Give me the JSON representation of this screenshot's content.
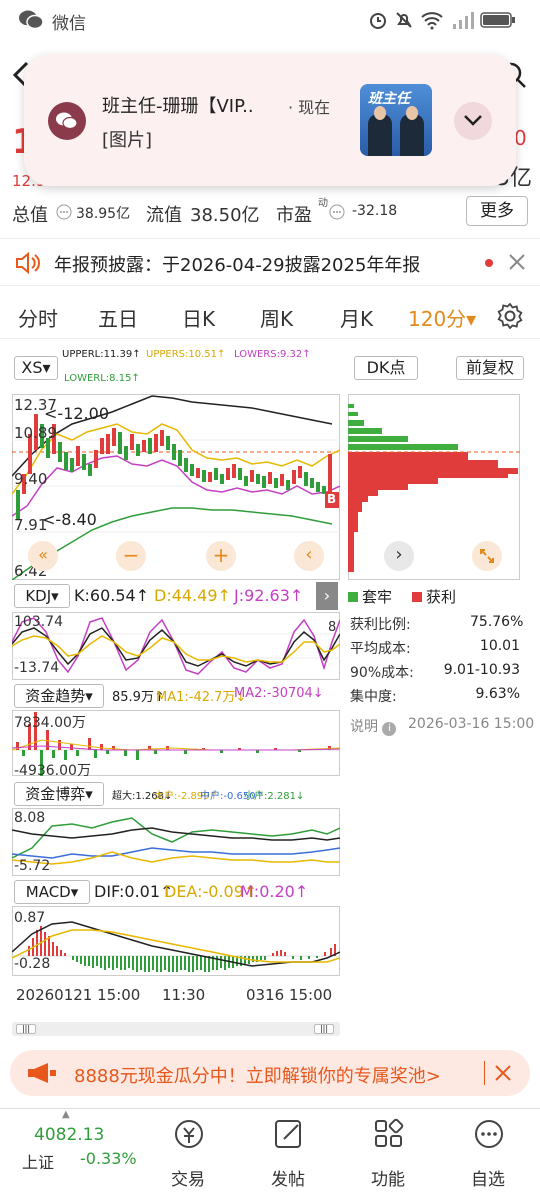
{
  "status": {
    "app": "微信"
  },
  "header": {
    "title_partial": "班主任"
  },
  "notification": {
    "title": "班主任-珊珊【VIP..",
    "time": "· 现在",
    "body": "[图片]",
    "thumb_text": "班主任"
  },
  "quote": {
    "price_partial": "1",
    "right_partial": "0",
    "row2_left": "12.9",
    "row2_right": "5亿",
    "total_value_label": "总值",
    "total_value": "38.95亿",
    "float_value_label": "流值",
    "float_value": "38.50亿",
    "pe_label": "市盈",
    "pe_sup": "动",
    "pe_value": "-32.18",
    "more_label": "更多"
  },
  "announcement": {
    "text": "年报预披露：于2026-04-29披露2025年年报"
  },
  "tabs": [
    {
      "label": "分时"
    },
    {
      "label": "五日"
    },
    {
      "label": "日K"
    },
    {
      "label": "周K"
    },
    {
      "label": "月K"
    },
    {
      "label": "120分▾"
    }
  ],
  "controls": {
    "indicator_select": "XS",
    "dk_label": "DK点",
    "adjust_label": "前复权",
    "upperl": "UPPERL:11.39↑",
    "uppers": "UPPERS:10.51↑",
    "lowers": "LOWERS:9.32↑",
    "lowerl": "LOWERL:8.15↑"
  },
  "main_chart": {
    "y_labels": [
      "12.37",
      "10.89",
      "9.40",
      "7.91",
      "6.42"
    ],
    "high_label": "12.00",
    "low_label": "8.40",
    "b_marker": "B"
  },
  "chip": {
    "legend_trapped": "套牢",
    "legend_profit": "获利",
    "rows": [
      {
        "label": "获利比例:",
        "value": "75.76%"
      },
      {
        "label": "平均成本:",
        "value": "10.01"
      },
      {
        "label": "90%成本:",
        "value": "9.01-10.93"
      },
      {
        "label": "集中度:",
        "value": "9.63%"
      }
    ],
    "note_label": "说明",
    "note_time": "2026-03-16 15:00"
  },
  "kdj": {
    "select": "KDJ",
    "k": "K:60.54↑",
    "d": "D:44.49↑",
    "j": "J:92.63↑",
    "y_top": "103.74",
    "y_bottom": "-13.74",
    "y_right": "8"
  },
  "fund_trend": {
    "select": "资金趋势",
    "v1": "85.9万↑",
    "ma1": "MA1:-42.7万↓",
    "ma2": "MA2:-30704↓",
    "y_top": "7834.00万",
    "y_bottom": "-4936.00万"
  },
  "fund_game": {
    "select": "资金博弈",
    "super": "超大:1.268↓",
    "big": "大户:-2.899↑",
    "mid": "中户:-0.650↑",
    "small": "小户:2.281↓",
    "y_top": "8.08",
    "y_bottom": "-5.72"
  },
  "macd": {
    "select": "MACD",
    "dif": "DIF:0.01↑",
    "dea": "DEA:-0.09↑",
    "m": "M:0.20↑",
    "y_top": "0.87",
    "y_bottom": "-0.28"
  },
  "x_axis": {
    "left": "20260121 15:00",
    "mid": "11:30",
    "right": "0316 15:00"
  },
  "banner": {
    "text": "8888元现金瓜分中！立即解锁你的专属奖池>"
  },
  "bottom_nav": {
    "index_value": "4082.13",
    "index_name": "上证",
    "index_change": "-0.33%",
    "items": [
      {
        "label": "交易"
      },
      {
        "label": "发帖"
      },
      {
        "label": "功能"
      },
      {
        "label": "自选"
      }
    ]
  },
  "colors": {
    "up": "#e03c3c",
    "down": "#2f9e3a",
    "accent": "#e28a1c",
    "uppers": "#e8b800",
    "lowers": "#c53fc5"
  }
}
